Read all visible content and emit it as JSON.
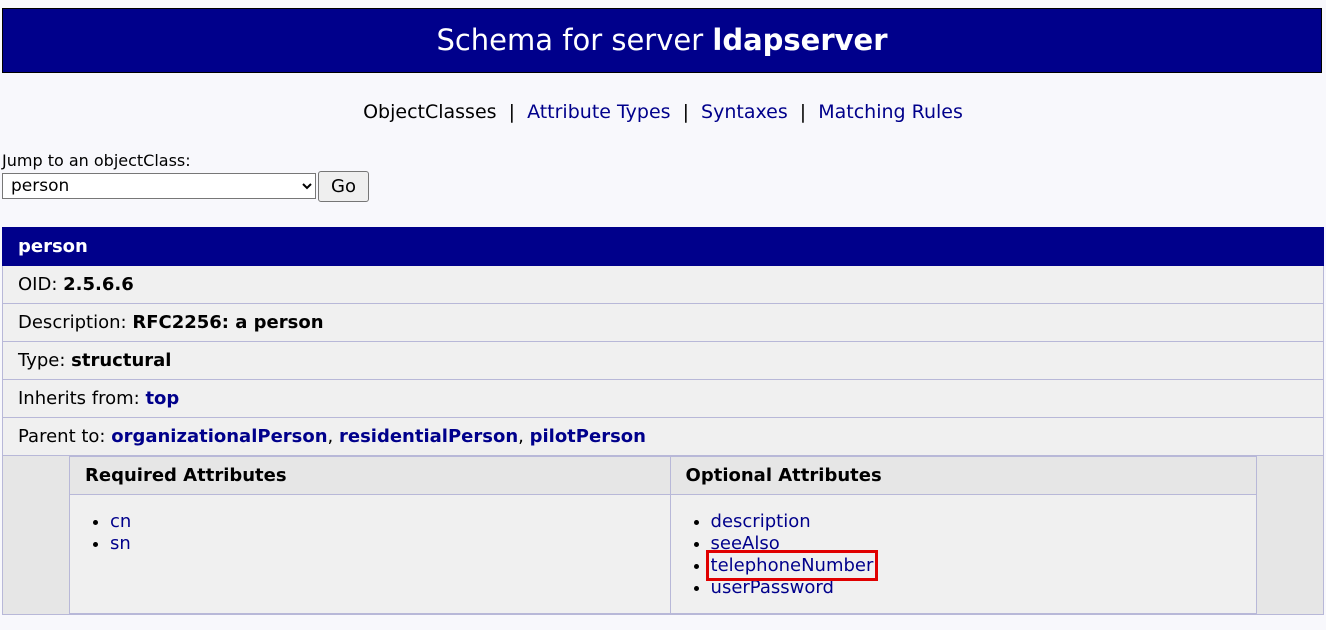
{
  "header": {
    "prefix": "Schema for server",
    "server": "ldapserver"
  },
  "nav": {
    "current": "ObjectClasses",
    "links": [
      "Attribute Types",
      "Syntaxes",
      "Matching Rules"
    ],
    "separator": "|"
  },
  "jump": {
    "label": "Jump to an objectClass:",
    "selected": "person",
    "go_label": "Go"
  },
  "objectclass": {
    "name": "person",
    "oid_label": "OID:",
    "oid": "2.5.6.6",
    "desc_label": "Description:",
    "desc": "RFC2256: a person",
    "type_label": "Type:",
    "type": "structural",
    "inherits_label": "Inherits from:",
    "inherits": "top",
    "parent_label": "Parent to:",
    "parents": [
      "organizationalPerson",
      "residentialPerson",
      "pilotPerson"
    ]
  },
  "required": {
    "heading": "Required Attributes",
    "items": [
      "cn",
      "sn"
    ]
  },
  "optional": {
    "heading": "Optional Attributes",
    "items": [
      "description",
      "seeAlso",
      "telephoneNumber",
      "userPassword"
    ],
    "highlighted": "telephoneNumber"
  },
  "colors": {
    "header_bg": "#00008b",
    "link": "#00008b",
    "highlight": "#e00000"
  }
}
